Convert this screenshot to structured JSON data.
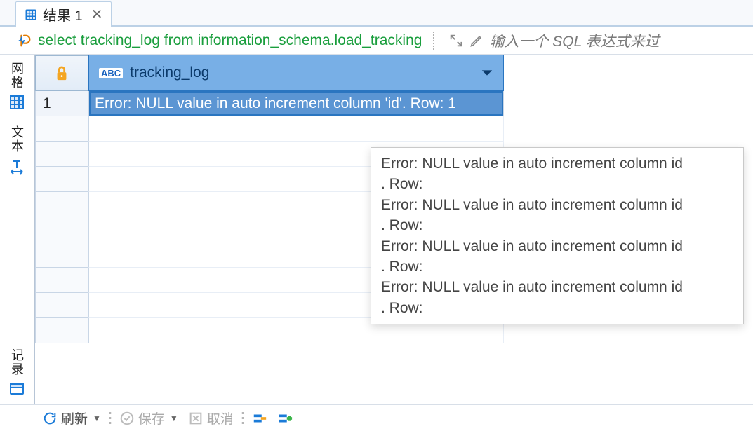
{
  "tab": {
    "label": "结果 1"
  },
  "sql": {
    "query": "select tracking_log from information_schema.load_tracking",
    "filter_placeholder": "输入一个 SQL 表达式来过"
  },
  "rail": {
    "grid_label": "网格",
    "text_label": "文本",
    "record_label": "记录"
  },
  "grid": {
    "column_type_badge": "ABC",
    "column_name": "tracking_log",
    "row_number": "1",
    "cell_value": "Error: NULL value in auto increment column 'id'. Row: 1"
  },
  "tooltip_text": "Error: NULL value in auto increment column id\n. Row:\nError: NULL value in auto increment column id\n. Row:\nError: NULL value in auto increment column id\n. Row:\nError: NULL value in auto increment column id\n. Row:",
  "footer": {
    "refresh": "刷新",
    "save": "保存",
    "cancel": "取消"
  }
}
